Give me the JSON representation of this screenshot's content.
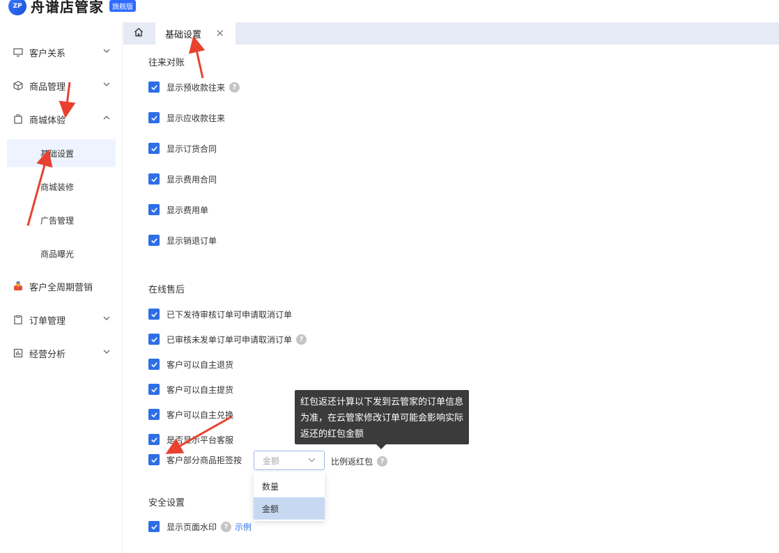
{
  "app": {
    "title": "舟谱店管家",
    "badge": "旗舰版",
    "logo_mark": "ZP"
  },
  "sidebar": {
    "items": [
      {
        "label": "客户关系",
        "icon": "monitor-icon",
        "expanded": false
      },
      {
        "label": "商品管理",
        "icon": "box-icon",
        "expanded": false
      },
      {
        "label": "商城体验",
        "icon": "shopping-bag-icon",
        "expanded": true
      },
      {
        "label": "客户全周期营销",
        "icon": "marketing-icon",
        "expanded": false
      },
      {
        "label": "订单管理",
        "icon": "clipboard-icon",
        "expanded": false
      },
      {
        "label": "经营分析",
        "icon": "chart-icon",
        "expanded": false
      }
    ],
    "subitems": [
      {
        "label": "基础设置",
        "active": true
      },
      {
        "label": "商城装修",
        "active": false
      },
      {
        "label": "广告管理",
        "active": false
      },
      {
        "label": "商品曝光",
        "active": false
      }
    ]
  },
  "tabs": {
    "home_icon": "home-icon",
    "active_label": "基础设置",
    "close_glyph": "✕"
  },
  "sections": {
    "reconcile": {
      "title": "往来对账",
      "options": [
        {
          "label": "显示预收款往来",
          "checked": true,
          "help": true
        },
        {
          "label": "显示应收款往来",
          "checked": true,
          "help": false
        },
        {
          "label": "显示订货合同",
          "checked": true,
          "help": false
        },
        {
          "label": "显示费用合同",
          "checked": true,
          "help": false
        },
        {
          "label": "显示费用单",
          "checked": true,
          "help": false
        },
        {
          "label": "显示销退订单",
          "checked": true,
          "help": false
        }
      ]
    },
    "after_sale": {
      "title": "在线售后",
      "options": [
        {
          "label": "已下发待审核订单可申请取消订单",
          "checked": true,
          "help": false
        },
        {
          "label": "已审核未发单订单可申请取消订单",
          "checked": true,
          "help": true
        },
        {
          "label": "客户可以自主退货",
          "checked": true,
          "help": false
        },
        {
          "label": "客户可以自主提货",
          "checked": true,
          "help": false
        },
        {
          "label": "客户可以自主兑换",
          "checked": true,
          "help": false
        },
        {
          "label": "是否显示平台客服",
          "checked": true,
          "help": false
        },
        {
          "label": "客户部分商品拒签按",
          "checked": true,
          "help": false
        }
      ],
      "ratio_select": {
        "value": "金额",
        "suffix": "比例返红包",
        "options": [
          "数量",
          "金额"
        ],
        "selected": "金额"
      }
    },
    "security": {
      "title": "安全设置",
      "options": [
        {
          "label": "显示页面水印",
          "checked": true,
          "help": true,
          "link": "示例"
        }
      ]
    }
  },
  "tooltip": {
    "text": "红包返还计算以下发到云管家的订单信息为准，在云管家修改订单可能会影响实际返还的红包金额"
  },
  "colors": {
    "accent": "#2e6ee6",
    "annotation": "#e8412f",
    "tooltip_bg": "#3b3b3b",
    "tab_strip": "#e6eaf5"
  }
}
